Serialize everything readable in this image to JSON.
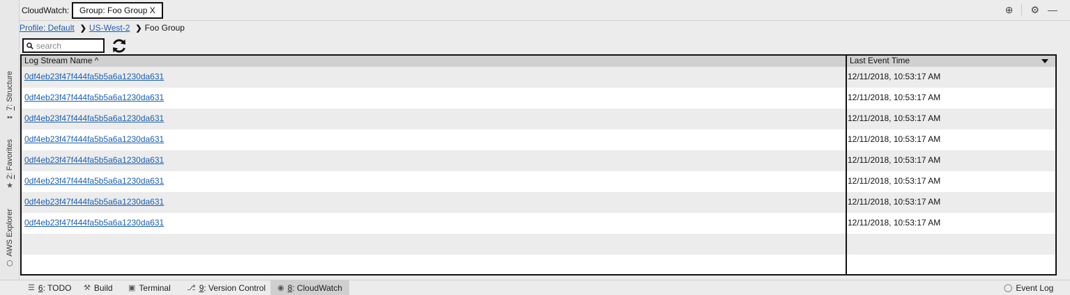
{
  "header": {
    "title": "CloudWatch:",
    "active_tab_label": "Group: Foo Group X"
  },
  "breadcrumb": {
    "profile": "Profile: Default",
    "region": "US-West-2",
    "group": "Foo Group"
  },
  "search": {
    "placeholder": "search",
    "value": ""
  },
  "table": {
    "columns": [
      "Log Stream Name ^",
      "Last Event Time"
    ],
    "rows": [
      {
        "name": "0df4eb23f47f444fa5b5a6a1230da631",
        "time": "12/11/2018, 10:53:17 AM"
      },
      {
        "name": "0df4eb23f47f444fa5b5a6a1230da631",
        "time": "12/11/2018, 10:53:17 AM"
      },
      {
        "name": "0df4eb23f47f444fa5b5a6a1230da631",
        "time": "12/11/2018, 10:53:17 AM"
      },
      {
        "name": "0df4eb23f47f444fa5b5a6a1230da631",
        "time": "12/11/2018, 10:53:17 AM"
      },
      {
        "name": "0df4eb23f47f444fa5b5a6a1230da631",
        "time": "12/11/2018, 10:53:17 AM"
      },
      {
        "name": "0df4eb23f47f444fa5b5a6a1230da631",
        "time": "12/11/2018, 10:53:17 AM"
      },
      {
        "name": "0df4eb23f47f444fa5b5a6a1230da631",
        "time": "12/11/2018, 10:53:17 AM"
      },
      {
        "name": "0df4eb23f47f444fa5b5a6a1230da631",
        "time": "12/11/2018, 10:53:17 AM"
      }
    ]
  },
  "left_tabs": {
    "structure": {
      "num": "7",
      "label": ": Structure"
    },
    "favorites": {
      "num": "2",
      "label": ": Favorites"
    },
    "aws_explorer": {
      "label": "AWS Explorer"
    }
  },
  "bottom_tabs": {
    "todo": {
      "num": "6",
      "label": ": TODO"
    },
    "build": {
      "label": "Build"
    },
    "terminal": {
      "label": "Terminal"
    },
    "version_control": {
      "num": "9",
      "label": ": Version Control"
    },
    "cloudwatch": {
      "num": "8",
      "label": ": CloudWatch"
    },
    "event_log": {
      "label": "Event Log"
    }
  },
  "colors": {
    "link": "#1a5fb4",
    "row_alt": "#ececec",
    "header_bg": "#d0d0d0",
    "border": "#111111"
  }
}
